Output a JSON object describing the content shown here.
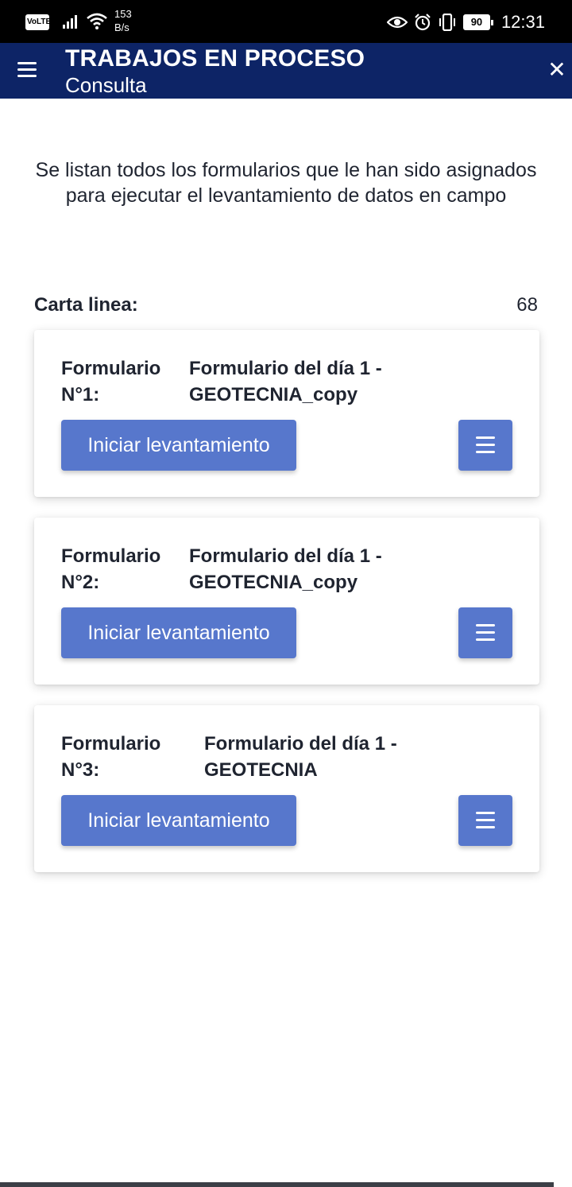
{
  "status_bar": {
    "network_badge": "VoLTE",
    "speed_value": "153",
    "speed_unit": "B/s",
    "battery": "90",
    "time": "12:31",
    "icons": [
      "volte-icon",
      "signal-icon",
      "wifi-icon",
      "eye-icon",
      "alarm-icon",
      "vibrate-icon",
      "battery-icon"
    ]
  },
  "header": {
    "title": "TRABAJOS EN PROCESO",
    "subtitle": "Consulta",
    "menu_icon": "hamburger-menu-icon",
    "close_icon": "close-icon"
  },
  "intro": {
    "text": "Se listan todos los formularios que le han sido asignados para ejecutar el levantamiento de datos en campo"
  },
  "carta": {
    "label": "Carta linea:",
    "value": "68"
  },
  "forms": [
    {
      "key_line1": "Formulario",
      "key_line2": "N°1:",
      "name_line1": "Formulario del día 1 -",
      "name_line2": "GEOTECNIA_copy",
      "button": "Iniciar levantamiento"
    },
    {
      "key_line1": "Formulario",
      "key_line2": "N°2:",
      "name_line1": "Formulario del día 1 -",
      "name_line2": "GEOTECNIA_copy",
      "button": "Iniciar levantamiento"
    },
    {
      "key_line1": "Formulario",
      "key_line2": "N°3:",
      "name_line1": "Formulario del día 1 -",
      "name_line2": "GEOTECNIA",
      "button": "Iniciar levantamiento"
    }
  ],
  "colors": {
    "header_bg": "#0d2466",
    "button_bg": "#5777cc",
    "text": "#1f2430"
  }
}
